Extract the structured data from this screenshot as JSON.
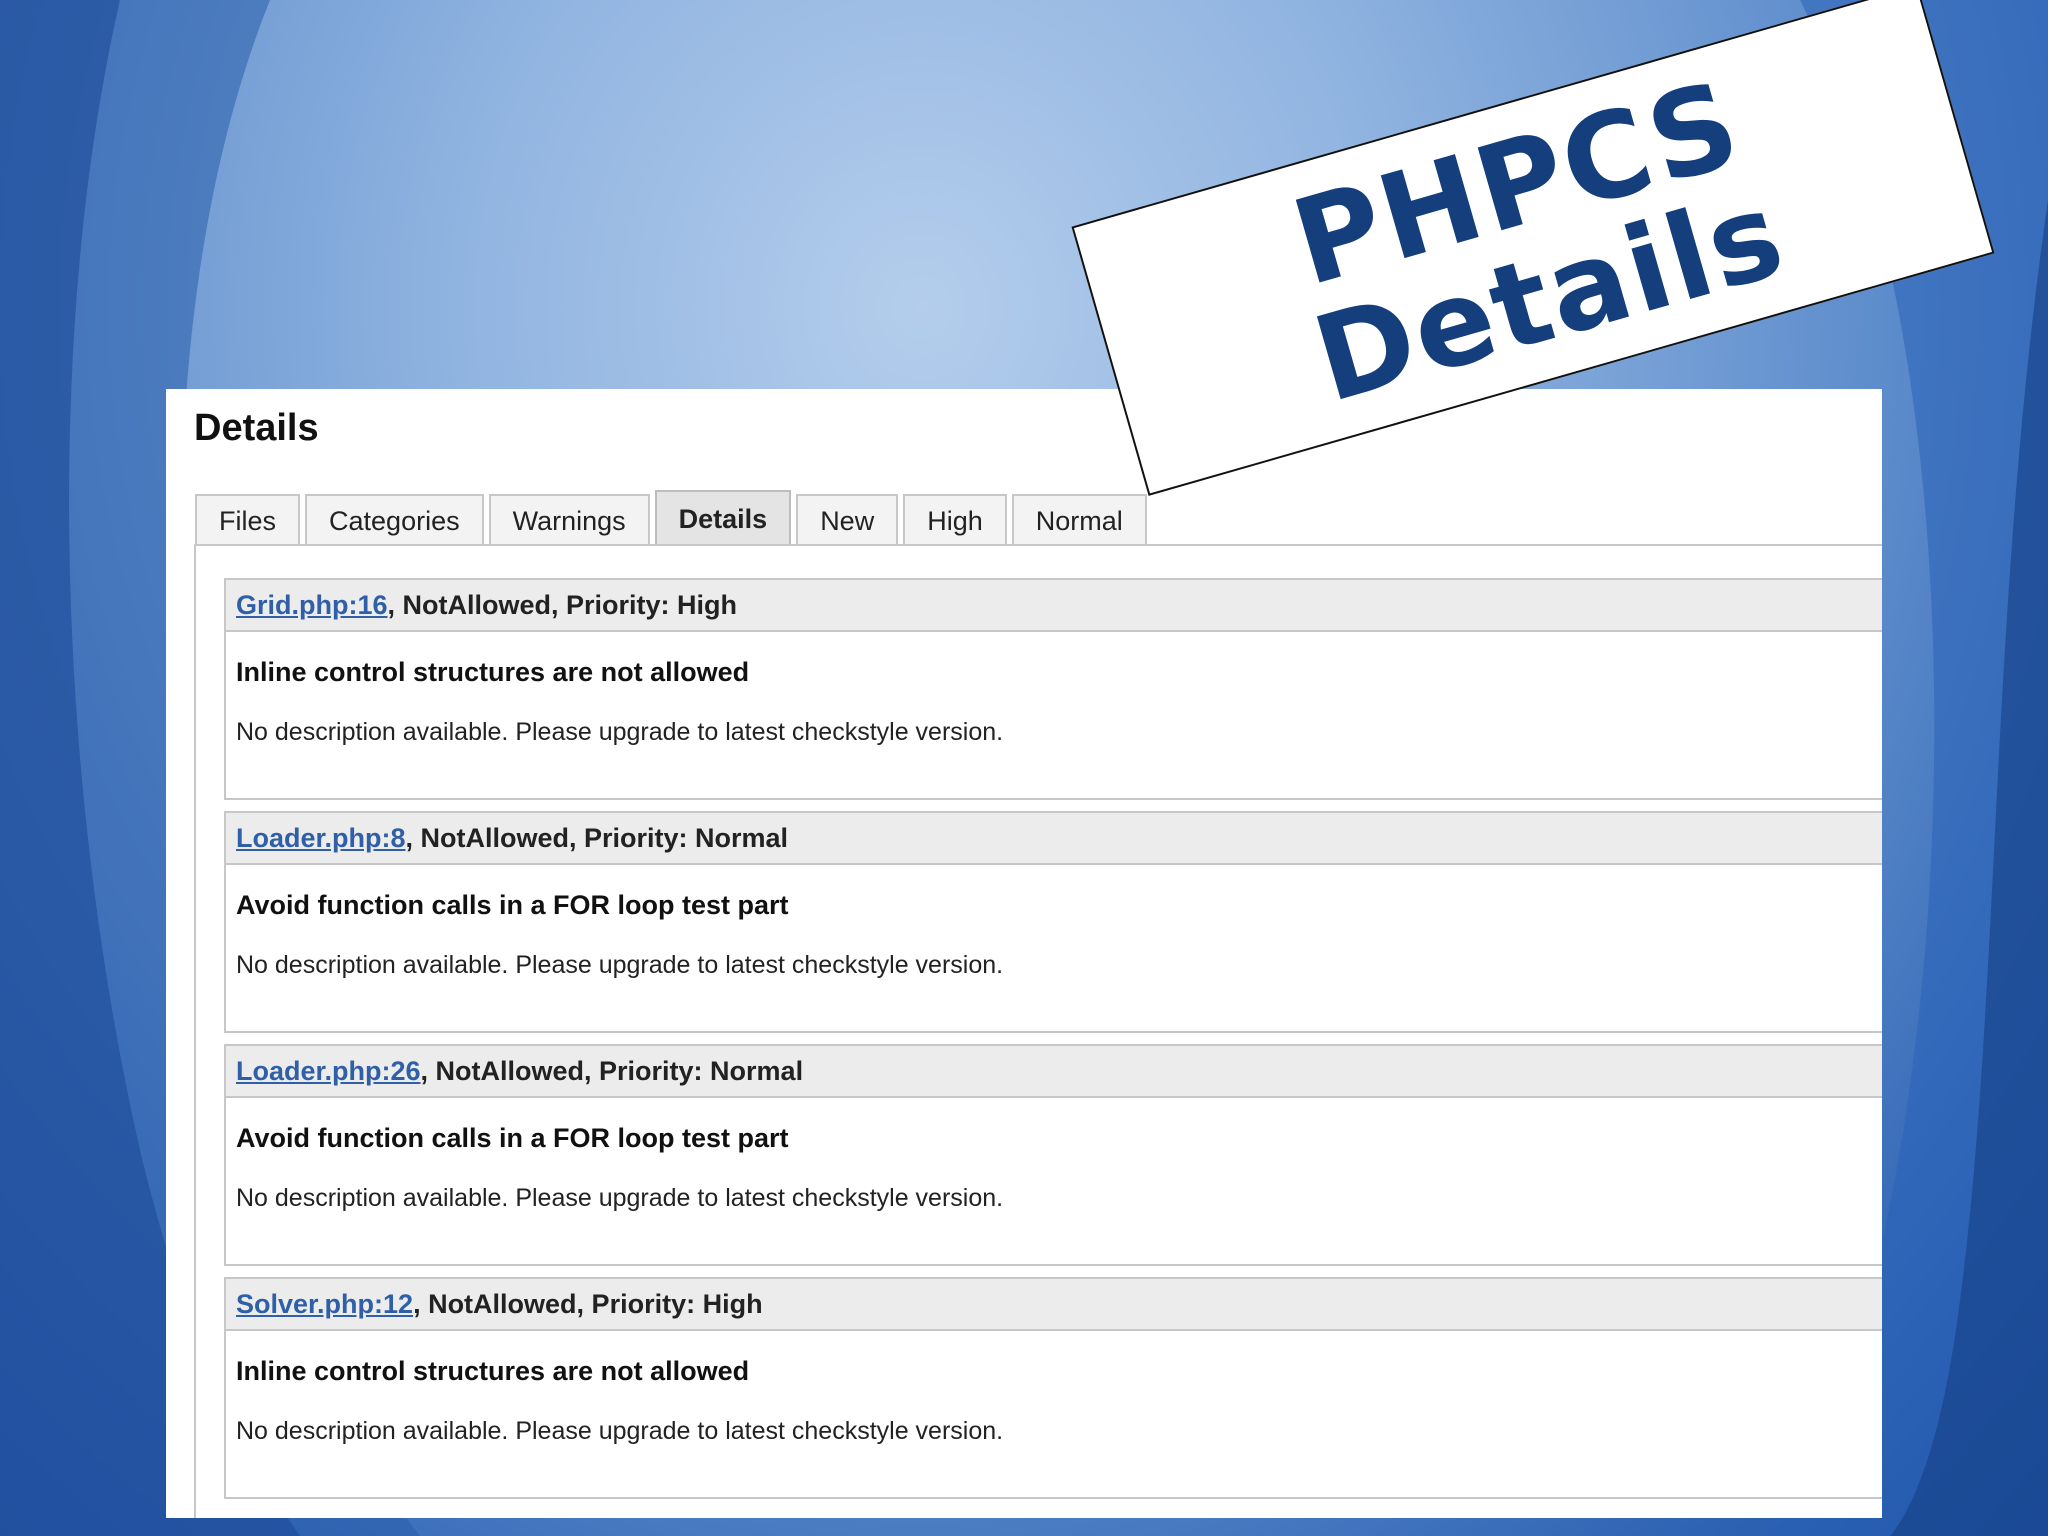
{
  "banner": {
    "line1": "PHPCS",
    "line2": "Details"
  },
  "page": {
    "title": "Details"
  },
  "tabs": [
    {
      "label": "Files",
      "active": false
    },
    {
      "label": "Categories",
      "active": false
    },
    {
      "label": "Warnings",
      "active": false
    },
    {
      "label": "Details",
      "active": true
    },
    {
      "label": "New",
      "active": false
    },
    {
      "label": "High",
      "active": false
    },
    {
      "label": "Normal",
      "active": false
    }
  ],
  "issues": [
    {
      "link": "Grid.php:16",
      "meta": ", NotAllowed, Priority: High",
      "title": "Inline control structures are not allowed",
      "description": "No description available. Please upgrade to latest checkstyle version."
    },
    {
      "link": "Loader.php:8",
      "meta": ", NotAllowed, Priority: Normal",
      "title": "Avoid function calls in a FOR loop test part",
      "description": "No description available. Please upgrade to latest checkstyle version."
    },
    {
      "link": "Loader.php:26",
      "meta": ", NotAllowed, Priority: Normal",
      "title": "Avoid function calls in a FOR loop test part",
      "description": "No description available. Please upgrade to latest checkstyle version."
    },
    {
      "link": "Solver.php:12",
      "meta": ", NotAllowed, Priority: High",
      "title": "Inline control structures are not allowed",
      "description": "No description available. Please upgrade to latest checkstyle version."
    }
  ],
  "colors": {
    "banner_text": "#143e7c",
    "link": "#2f5fa7",
    "background_light": "#b4cdec",
    "background_dark": "#1c4c9c"
  }
}
